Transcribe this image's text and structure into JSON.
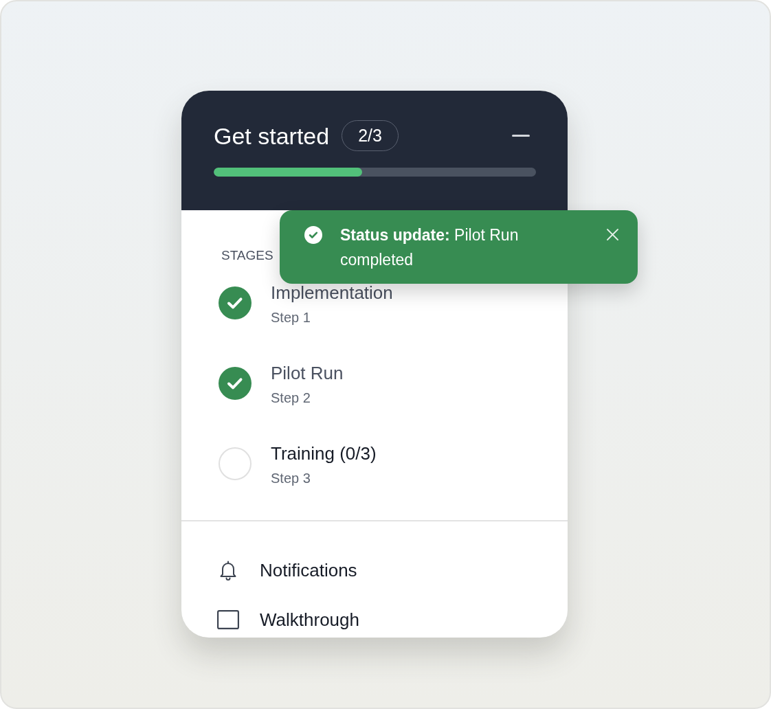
{
  "panel": {
    "title": "Get started",
    "progress_badge": "2/3",
    "progress": {
      "level": 0.46
    },
    "section_label": "STAGES",
    "stages": [
      {
        "title": "Implementation",
        "subtitle": "Step 1",
        "completed": true
      },
      {
        "title": "Pilot Run",
        "subtitle": "Step 2",
        "completed": true
      },
      {
        "title": "Training (0/3)",
        "subtitle": "Step 3",
        "completed": false
      }
    ],
    "menu_items": [
      {
        "label": "Notifications"
      },
      {
        "label": "Walkthrough"
      }
    ]
  },
  "toast": {
    "message": "**Status update:** Pilot Run completed"
  }
}
